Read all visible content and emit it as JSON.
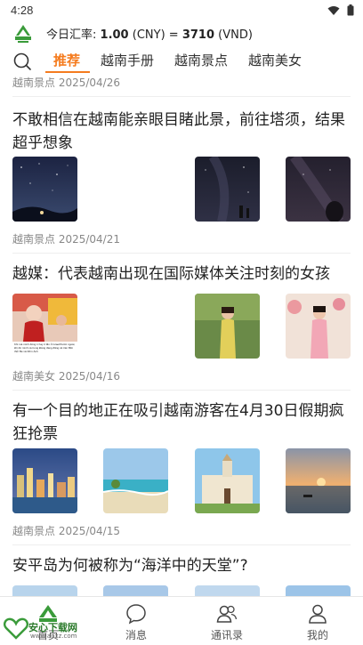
{
  "status_bar": {
    "time": "4:28",
    "wifi_icon": "wifi-icon",
    "battery_icon": "battery-icon"
  },
  "header": {
    "logo_name": "app-logo",
    "rate_label": "今日汇率:",
    "cny_amount": "1.00",
    "cny_code": "(CNY)",
    "equals": "=",
    "vnd_amount": "3710",
    "vnd_code": "(VND)"
  },
  "tabs": [
    {
      "label": "推荐",
      "active": true
    },
    {
      "label": "越南手册",
      "active": false
    },
    {
      "label": "越南景点",
      "active": false
    },
    {
      "label": "越南美女",
      "active": false
    }
  ],
  "feed": {
    "top_meta": "越南景点 2025/04/26",
    "articles": [
      {
        "title": "不敢相信在越南能亲眼目睹此景，前往塔须，结果超乎想象",
        "meta": "越南景点 2025/04/21"
      },
      {
        "title": "越媒：代表越南出现在国际媒体关注时刻的女孩",
        "meta": "越南美女 2025/04/16",
        "thumb1_caption": "Khi mà mình đóng 1 hay 2 lần ở Israel/Nước ngoài, khi đó mình và trong Đảng đang đăng cả trên Bất thủ/ Bé và Nhìn Ảnh"
      },
      {
        "title": "有一个目的地正在吸引越南游客在4月30日假期疯狂抢票",
        "meta": "越南景点 2025/04/15"
      },
      {
        "title": "安平岛为何被称为“海洋中的天堂”?"
      }
    ]
  },
  "bottom_nav": {
    "items": [
      {
        "label": "首页",
        "icon": "home-icon"
      },
      {
        "label": "消息",
        "icon": "message-icon"
      },
      {
        "label": "通讯录",
        "icon": "contacts-icon"
      },
      {
        "label": "我的",
        "icon": "profile-icon"
      }
    ],
    "watermark_main": "安心下载网",
    "watermark_sub": "www.anxz.com"
  },
  "colors": {
    "accent_orange": "#f57c1f",
    "logo_green": "#3a9b3a",
    "text_dark": "#222222",
    "meta_gray": "#888888",
    "divider": "#eeeeee"
  }
}
